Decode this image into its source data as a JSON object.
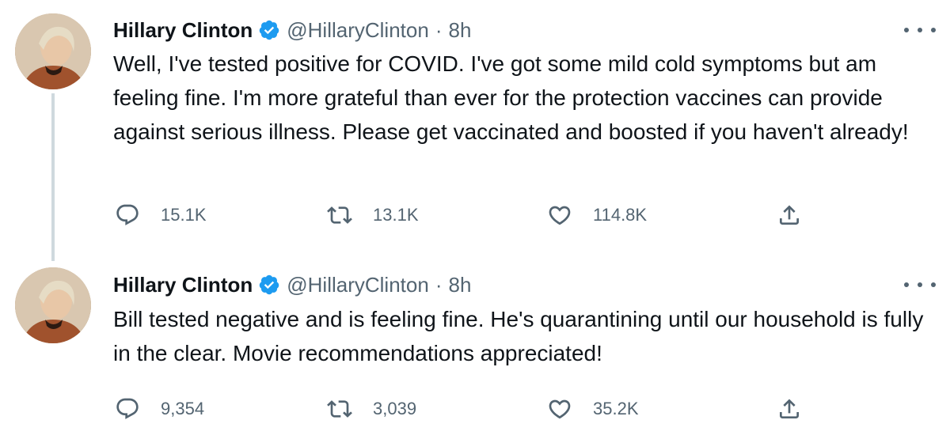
{
  "tweets": [
    {
      "author": {
        "name": "Hillary Clinton",
        "handle": "@HillaryClinton"
      },
      "time": "8h",
      "separator": "·",
      "text": "Well, I've tested positive for COVID. I've got some mild cold symptoms but am feeling fine. I'm more grateful than ever for the protection vaccines can provide against serious illness. Please get vaccinated and boosted if you haven't already!",
      "replies": "15.1K",
      "retweets": "13.1K",
      "likes": "114.8K"
    },
    {
      "author": {
        "name": "Hillary Clinton",
        "handle": "@HillaryClinton"
      },
      "time": "8h",
      "separator": "·",
      "text": "Bill tested negative and is feeling fine. He's quarantining until our household is fully in the clear. Movie recommendations appreciated!",
      "replies": "9,354",
      "retweets": "3,039",
      "likes": "35.2K"
    }
  ],
  "icons": {
    "verified": "verified-badge-icon",
    "more": "more-options-icon",
    "reply": "reply-icon",
    "retweet": "retweet-icon",
    "like": "like-icon",
    "share": "share-icon"
  },
  "colors": {
    "verified": "#1d9bf0",
    "secondary_text": "#536471",
    "primary_text": "#0f1419",
    "thread_line": "#cfd9de"
  }
}
